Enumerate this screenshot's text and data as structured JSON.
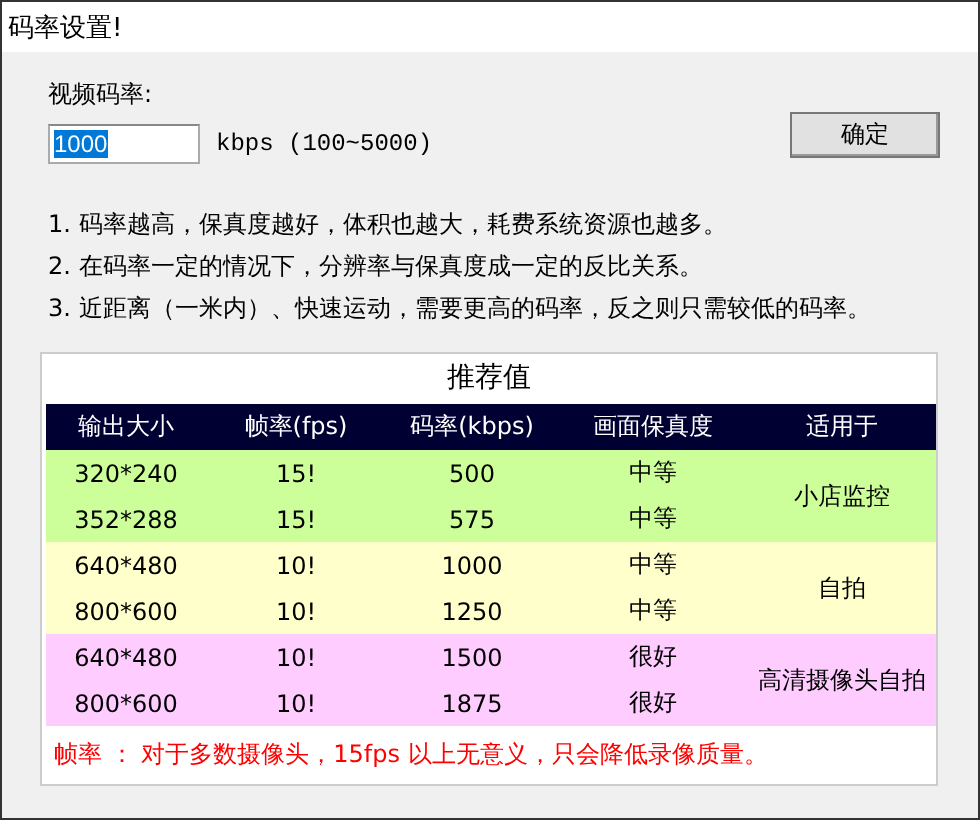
{
  "window": {
    "title": "码率设置!"
  },
  "bitrate_label": "视频码率:",
  "bitrate_field": {
    "value": "1000",
    "selected": true
  },
  "bitrate_unit": "kbps (100~5000)",
  "ok_button": "确定",
  "notes": [
    "1. 码率越高，保真度越好，体积也越大，耗费系统资源也越多。",
    "2. 在码率一定的情况下，分辨率与保真度成一定的反比关系。",
    "3. 近距离（一米内）、快速运动，需要更高的码率，反之则只需较低的码率。"
  ],
  "table": {
    "title": "推荐值",
    "columns": [
      "输出大小",
      "帧率(fps)",
      "码率(kbps)",
      "画面保真度",
      "适用于"
    ],
    "groups": [
      {
        "color": "#ccff99",
        "use": "小店监控",
        "rows": [
          [
            "320*240",
            "15!",
            "500",
            "中等"
          ],
          [
            "352*288",
            "15!",
            "575",
            "中等"
          ]
        ]
      },
      {
        "color": "#ffffcc",
        "use": "自拍",
        "rows": [
          [
            "640*480",
            "10!",
            "1000",
            "中等"
          ],
          [
            "800*600",
            "10!",
            "1250",
            "中等"
          ]
        ]
      },
      {
        "color": "#ffccff",
        "use": "高清摄像头自拍",
        "rows": [
          [
            "640*480",
            "10!",
            "1500",
            "很好"
          ],
          [
            "800*600",
            "10!",
            "1875",
            "很好"
          ]
        ]
      }
    ],
    "footnote": "帧率 ： 对于多数摄像头，15fps 以上无意义，只会降低录像质量。"
  }
}
